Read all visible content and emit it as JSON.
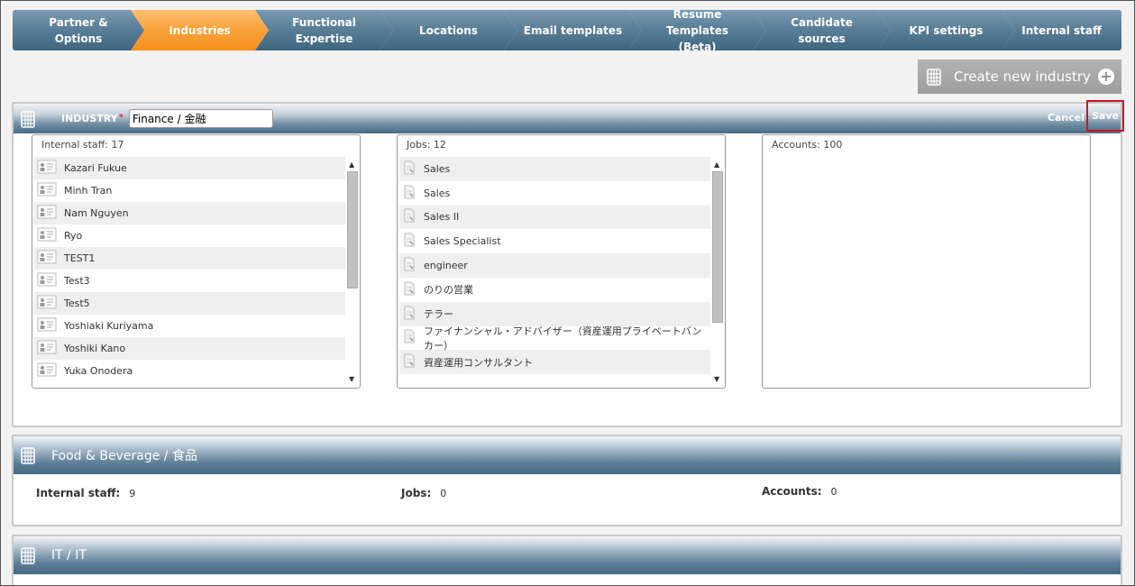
{
  "tabs": [
    {
      "label": "Partner & Options"
    },
    {
      "label": "Industries"
    },
    {
      "label": "Functional\nExpertise"
    },
    {
      "label": "Locations"
    },
    {
      "label": "Email templates"
    },
    {
      "label": "Resume Templates\n(Beta)"
    },
    {
      "label": "Candidate sources"
    },
    {
      "label": "KPI settings"
    },
    {
      "label": "Internal staff"
    }
  ],
  "create_button": {
    "label": "Create new industry"
  },
  "editor": {
    "industry_label": "INDUSTRY",
    "required_mark": "*",
    "industry_value": "Finance / 金融",
    "cancel_label": "Cancel",
    "save_label": "Save",
    "staff_header": "Internal staff: 17",
    "staff": [
      "Kazari Fukue",
      "Minh Tran",
      "Nam Nguyen",
      "Ryo",
      "TEST1",
      "Test3",
      "Test5",
      "Yoshiaki Kuriyama",
      "Yoshiki Kano",
      "Yuka Onodera"
    ],
    "jobs_header": "Jobs: 12",
    "jobs": [
      "Sales",
      "Sales",
      "Sales II",
      "Sales Specialist",
      "engineer",
      "のりの営業",
      "テラー",
      "ファイナンシャル・アドバイザー（資産運用プライベートバンカー）",
      "資産運用コンサルタント"
    ],
    "accounts_header": "Accounts: 100"
  },
  "food": {
    "title": "Food & Beverage / 食品",
    "staff_label": "Internal staff:",
    "staff_value": "9",
    "jobs_label": "Jobs:",
    "jobs_value": "0",
    "accounts_label": "Accounts:",
    "accounts_value": "0"
  },
  "it": {
    "title": "IT / IT"
  },
  "colors": {
    "active_tab": "#f9a13a",
    "tab": "#5b7f99",
    "save_highlight": "#c8161d"
  }
}
